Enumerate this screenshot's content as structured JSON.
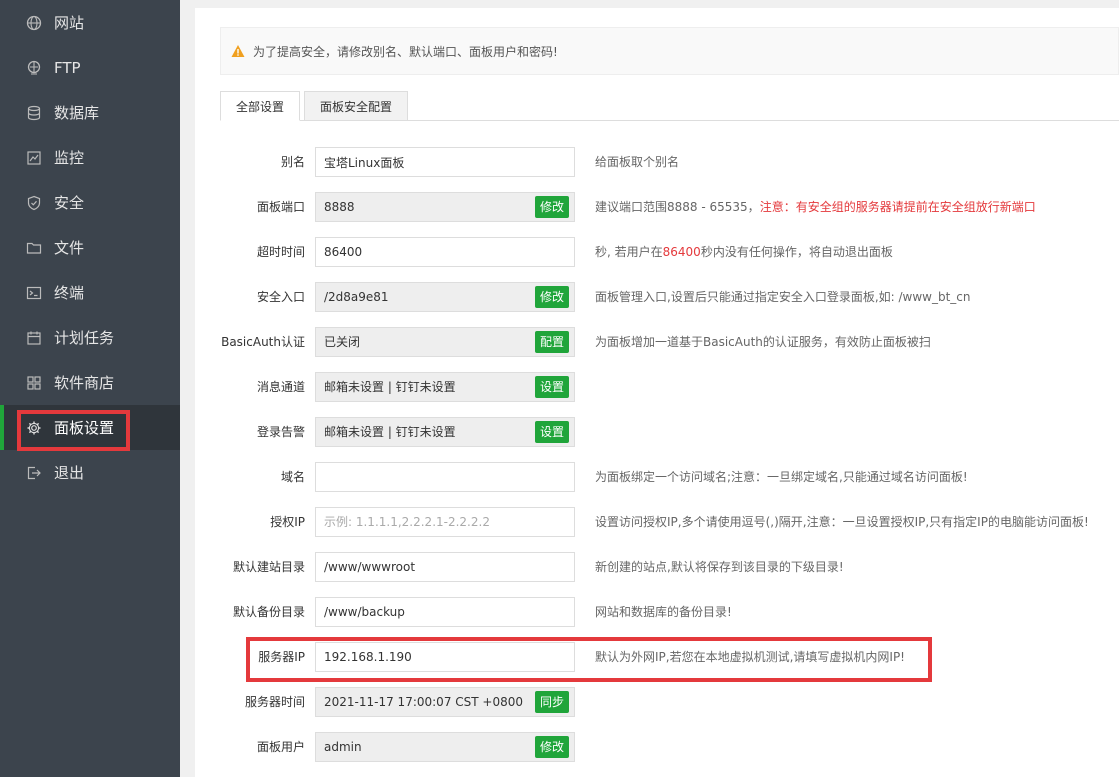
{
  "sidebar": {
    "items": [
      {
        "label": "网站",
        "icon": "globe-icon"
      },
      {
        "label": "FTP",
        "icon": "ftp-icon"
      },
      {
        "label": "数据库",
        "icon": "database-icon"
      },
      {
        "label": "监控",
        "icon": "monitor-icon"
      },
      {
        "label": "安全",
        "icon": "shield-icon"
      },
      {
        "label": "文件",
        "icon": "folder-icon"
      },
      {
        "label": "终端",
        "icon": "terminal-icon"
      },
      {
        "label": "计划任务",
        "icon": "calendar-icon"
      },
      {
        "label": "软件商店",
        "icon": "grid-icon"
      },
      {
        "label": "面板设置",
        "icon": "gear-icon"
      },
      {
        "label": "退出",
        "icon": "logout-icon"
      }
    ],
    "active_index": 9
  },
  "warning": {
    "text": "为了提高安全，请修改别名、默认端口、面板用户和密码!"
  },
  "tabs": [
    {
      "label": "全部设置"
    },
    {
      "label": "面板安全配置"
    }
  ],
  "settings": {
    "alias": {
      "label": "别名",
      "value": "宝塔Linux面板",
      "desc": "给面板取个别名"
    },
    "port": {
      "label": "面板端口",
      "value": "8888",
      "button": "修改",
      "desc": "建议端口范围8888 - 65535，",
      "desc_red": "注意：有安全组的服务器请提前在安全组放行新端口"
    },
    "timeout": {
      "label": "超时时间",
      "value": "86400",
      "desc_pre": "秒, 若用户在",
      "desc_red": "86400",
      "desc_post": "秒内没有任何操作，将自动退出面板"
    },
    "entry": {
      "label": "安全入口",
      "value": "/2d8a9e81",
      "button": "修改",
      "desc": "面板管理入口,设置后只能通过指定安全入口登录面板,如: /www_bt_cn"
    },
    "basicauth": {
      "label": "BasicAuth认证",
      "value": "已关闭",
      "button": "配置",
      "desc": "为面板增加一道基于BasicAuth的认证服务，有效防止面板被扫"
    },
    "channel": {
      "label": "消息通道",
      "value": "邮箱未设置 | 钉钉未设置",
      "button": "设置"
    },
    "alarm": {
      "label": "登录告警",
      "value": "邮箱未设置 | 钉钉未设置",
      "button": "设置"
    },
    "domain": {
      "label": "域名",
      "value": "",
      "desc": "为面板绑定一个访问域名;注意：一旦绑定域名,只能通过域名访问面板!"
    },
    "authip": {
      "label": "授权IP",
      "placeholder": "示例: 1.1.1.1,2.2.2.1-2.2.2.2",
      "desc": "设置访问授权IP,多个请使用逗号(,)隔开,注意：一旦设置授权IP,只有指定IP的电脑能访问面板!"
    },
    "site_dir": {
      "label": "默认建站目录",
      "value": "/www/wwwroot",
      "desc": "新创建的站点,默认将保存到该目录的下级目录!"
    },
    "backup_dir": {
      "label": "默认备份目录",
      "value": "/www/backup",
      "desc": "网站和数据库的备份目录!"
    },
    "server_ip": {
      "label": "服务器IP",
      "value": "192.168.1.190",
      "desc": "默认为外网IP,若您在本地虚拟机测试,请填写虚拟机内网IP!"
    },
    "server_time": {
      "label": "服务器时间",
      "value": "2021-11-17 17:00:07 CST +0800",
      "button": "同步"
    },
    "user": {
      "label": "面板用户",
      "value": "admin",
      "button": "修改"
    }
  },
  "colors": {
    "accent": "#20a53a",
    "highlight": "#e4393c",
    "sidebar": "#3c444d"
  }
}
